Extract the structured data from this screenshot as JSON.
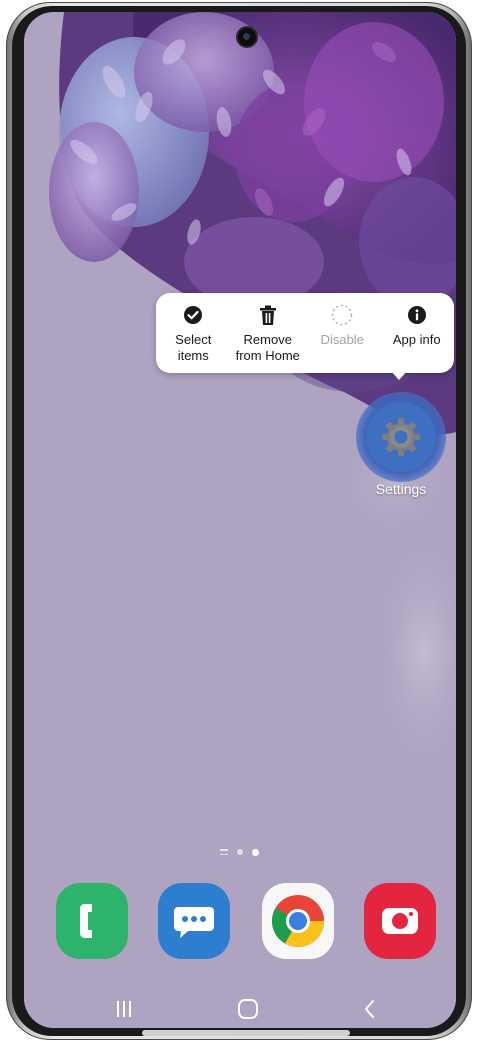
{
  "context_menu": {
    "items": [
      {
        "label": "Select\nitems",
        "icon": "check-circle-icon",
        "enabled": true
      },
      {
        "label": "Remove\nfrom Home",
        "icon": "trash-icon",
        "enabled": true
      },
      {
        "label": "Disable",
        "icon": "dashed-circle-icon",
        "enabled": false
      },
      {
        "label": "App info",
        "icon": "info-icon",
        "enabled": true
      }
    ]
  },
  "selected_app": {
    "label": "Settings",
    "icon": "gear-icon"
  },
  "home_pages": {
    "current": 2,
    "total": 2
  },
  "dock": {
    "apps": [
      {
        "name": "phone",
        "icon": "phone-icon",
        "color": "#2db36b"
      },
      {
        "name": "messages",
        "icon": "messages-icon",
        "color": "#2e7ed0"
      },
      {
        "name": "chrome",
        "icon": "chrome-icon",
        "color": "#f7f7f7"
      },
      {
        "name": "camera",
        "icon": "camera-icon",
        "color": "#e3253f"
      }
    ]
  },
  "navigation": {
    "buttons": [
      {
        "name": "recents",
        "icon": "recents-icon"
      },
      {
        "name": "home",
        "icon": "home-icon"
      },
      {
        "name": "back",
        "icon": "back-icon"
      }
    ]
  },
  "colors": {
    "wallpaper": "#aea3c1",
    "accent": "#3f6fc0"
  }
}
